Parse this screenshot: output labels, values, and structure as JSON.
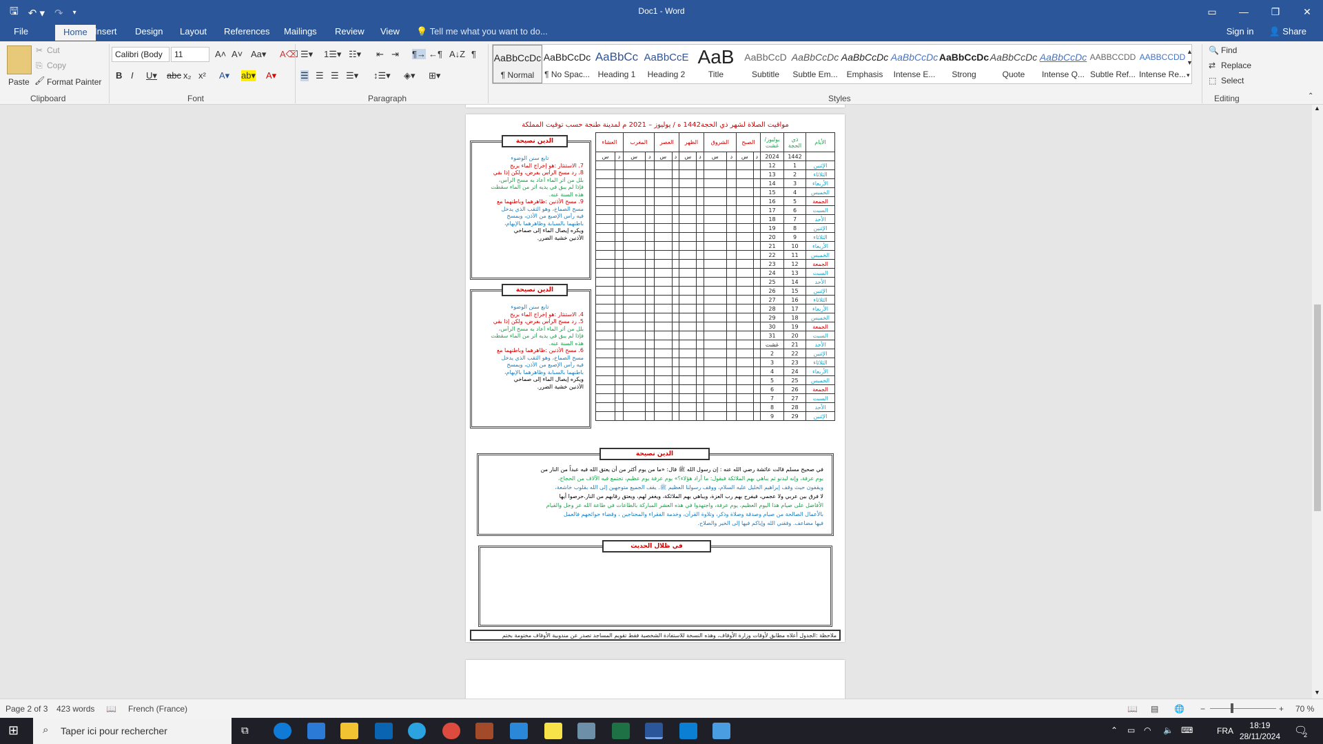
{
  "window": {
    "title": "Doc1 - Word",
    "controls": [
      "restore",
      "minimize",
      "maximize",
      "close"
    ]
  },
  "tabs": {
    "items": [
      "File",
      "Home",
      "Insert",
      "Design",
      "Layout",
      "References",
      "Mailings",
      "Review",
      "View"
    ],
    "active": "Home",
    "tell_me": "Tell me what you want to do...",
    "sign_in": "Sign in",
    "share": "Share"
  },
  "ribbon": {
    "clipboard": {
      "paste": "Paste",
      "cut": "Cut",
      "copy": "Copy",
      "format_painter": "Format Painter",
      "label": "Clipboard"
    },
    "font": {
      "name": "Calibri (Body",
      "size": "11",
      "label": "Font"
    },
    "paragraph": {
      "label": "Paragraph"
    },
    "styles": {
      "label": "Styles",
      "items": [
        {
          "preview": "AaBbCcDc",
          "name": "¶ Normal"
        },
        {
          "preview": "AaBbCcDc",
          "name": "¶ No Spac..."
        },
        {
          "preview": "AaBbCc",
          "name": "Heading 1"
        },
        {
          "preview": "AaBbCcE",
          "name": "Heading 2"
        },
        {
          "preview": "AaB",
          "name": "Title"
        },
        {
          "preview": "AaBbCcD",
          "name": "Subtitle"
        },
        {
          "preview": "AaBbCcDc",
          "name": "Subtle Em..."
        },
        {
          "preview": "AaBbCcDc",
          "name": "Emphasis"
        },
        {
          "preview": "AaBbCcDc",
          "name": "Intense E..."
        },
        {
          "preview": "AaBbCcDc",
          "name": "Strong"
        },
        {
          "preview": "AaBbCcDc",
          "name": "Quote"
        },
        {
          "preview": "AaBbCcDc",
          "name": "Intense Q..."
        },
        {
          "preview": "AABBCCDD",
          "name": "Subtle Ref..."
        },
        {
          "preview": "AABBCCDD",
          "name": "Intense Re..."
        }
      ]
    },
    "editing": {
      "find": "Find",
      "replace": "Replace",
      "select": "Select",
      "label": "Editing"
    }
  },
  "document": {
    "heading": "مواقيت الصلاة لشهر ذي الحجة1442 ه / يوليوز – 2021 م لمدينة طنجة حسب توقيت المملكة",
    "box_title": "الدين نصيحة",
    "box_lines_1": [
      "تابع سنن الوضوء",
      "7. الاستنثار :هو إخراج الماء بريح",
      "8. رد مسح الرأس بفرض، ولكن إذا بقي",
      "بلل من أثر الماء أعاد به مسح الرأس،",
      "فإذا لم يبق في يديه أثر من الماء سقطت",
      "هذه السنة عنه.",
      "9. مسح الأذنين :ظاهرهما وباطنهما مع",
      "مسح الصماخ، وهو الثقب الذي يدخل",
      "فيه رأس الإصبع من الأذن، ويمسح",
      "باطنهما بالسبابة وظاهرهما بالإبهام،",
      "ويكره إيصال الماء إلى صماخي",
      "الأذنين خشية الضرر."
    ],
    "box_lines_2": [
      "تابع سنن الوضوء",
      "4. الاستنثار :هو إخراج الماء بريح",
      "5. رد مسح الرأس بفرض، ولكن إذا بقي",
      "بلل من أثر الماء أعاد به مسح الرأس،",
      "فإذا لم يبق في يديه أثر من الماء سقطت",
      "هذه السنة عنه.",
      "6. مسح الأذنين :ظاهرهما وباطنهما مع",
      "مسح الصماخ، وهو الثقب الذي يدخل",
      "فيه رأس الإصبع من الأذن، ويمسح",
      "باطنهما بالسبابة وظاهرهما بالإبهام،",
      "ويكره إيصال الماء إلى صماخي",
      "الأذنين خشية الضرر."
    ],
    "table_headers": [
      "الأيام",
      "ذي الحجة",
      "يوليوز/ غشت",
      "الصبح",
      "الشروق",
      "الظهر",
      "العصر",
      "المغرب",
      "العشاء"
    ],
    "year_row": [
      "1442",
      "2024"
    ],
    "unit_labels": [
      "د",
      "س"
    ],
    "rows": [
      [
        "الإثنين",
        "1",
        "12"
      ],
      [
        "الثلاثاء",
        "2",
        "13"
      ],
      [
        "الأربعاء",
        "3",
        "14"
      ],
      [
        "الخميس",
        "4",
        "15"
      ],
      [
        "الجمعة",
        "5",
        "16"
      ],
      [
        "السبت",
        "6",
        "17"
      ],
      [
        "الأحد",
        "7",
        "18"
      ],
      [
        "الإثنين",
        "8",
        "19"
      ],
      [
        "الثلاثاء",
        "9",
        "20"
      ],
      [
        "الأربعاء",
        "10",
        "21"
      ],
      [
        "الخميس",
        "11",
        "22"
      ],
      [
        "الجمعة",
        "12",
        "23"
      ],
      [
        "السبت",
        "13",
        "24"
      ],
      [
        "الأحد",
        "14",
        "25"
      ],
      [
        "الإثنين",
        "15",
        "26"
      ],
      [
        "الثلاثاء",
        "16",
        "27"
      ],
      [
        "الأربعاء",
        "17",
        "28"
      ],
      [
        "الخميس",
        "18",
        "29"
      ],
      [
        "الجمعة",
        "19",
        "30"
      ],
      [
        "السبت",
        "20",
        "31"
      ],
      [
        "الأحد",
        "21",
        "غشت"
      ],
      [
        "الإثنين",
        "22",
        "2"
      ],
      [
        "الثلاثاء",
        "23",
        "3"
      ],
      [
        "الأربعاء",
        "24",
        "4"
      ],
      [
        "الخميس",
        "25",
        "5"
      ],
      [
        "الجمعة",
        "26",
        "6"
      ],
      [
        "السبت",
        "27",
        "7"
      ],
      [
        "الأحد",
        "28",
        "8"
      ],
      [
        "الإثنين",
        "29",
        "9"
      ]
    ],
    "advice_title": "الدين نصيحة",
    "advice_lines": [
      "في صحيح مسلم قالت عائشة رضي الله عنه : إن رسول الله ﷺ قال: «ما من يوم أكثر من أن يعتق الله فيه عبداً من النار من",
      "يوم عرفة، وإنه ليدنو ثم يباهي بهم الملائكة فيقول: ما أراد هؤلاء؟» يوم عرفة يوم عظيم، تجتمع فيه الآلاف من الحجاج،",
      "ويقفون حيث وقف إبراهيم الخليل عليه السلام، ووقف رسولنا العظيم ﷺ. يقف الجميع متوجهين إلى الله بقلوب خاشعة،",
      "لا فرق بين عربي ولا عجمي، فيفرح بهم رب العزة، ويباهي بهم الملائكة، ويغفر لهم، ويعتق رقابهم من النار.حرصوا أيها",
      "الأفاضل على صيام هذا اليوم العظيم، يوم عرفة، واجتهدوا في هذه العشر المباركة بالطاعات في طاعة الله عز وجل والقيام",
      "بالأعمال الصالحة من صيام وصدقة وصلاة وذكر، وتلاوة القرآن، وخدمة الفقراء والمحتاجين ، وقضاء حوائجهم فالعمل",
      "فيها مضاعف. وفقني الله وإياكم فيها إلى الخير والصلاح."
    ],
    "hadith_title": "في ظلال الحديث",
    "note": "ملاحظة :الجدول أعلاه مطابق لأوقات وزارة الأوقاف، وهذه النسخة للاستفادة الشخصية فقط تقويم المساجد تصدر عن مندوبية الأوقاف مختومة بختم"
  },
  "status": {
    "page": "Page 2 of 3",
    "words": "423 words",
    "language": "French (France)",
    "zoom": "70 %"
  },
  "taskbar": {
    "search_placeholder": "Taper ici pour rechercher",
    "lang": "FRA",
    "time": "18:19",
    "date": "28/11/2024",
    "notifications": "2"
  }
}
